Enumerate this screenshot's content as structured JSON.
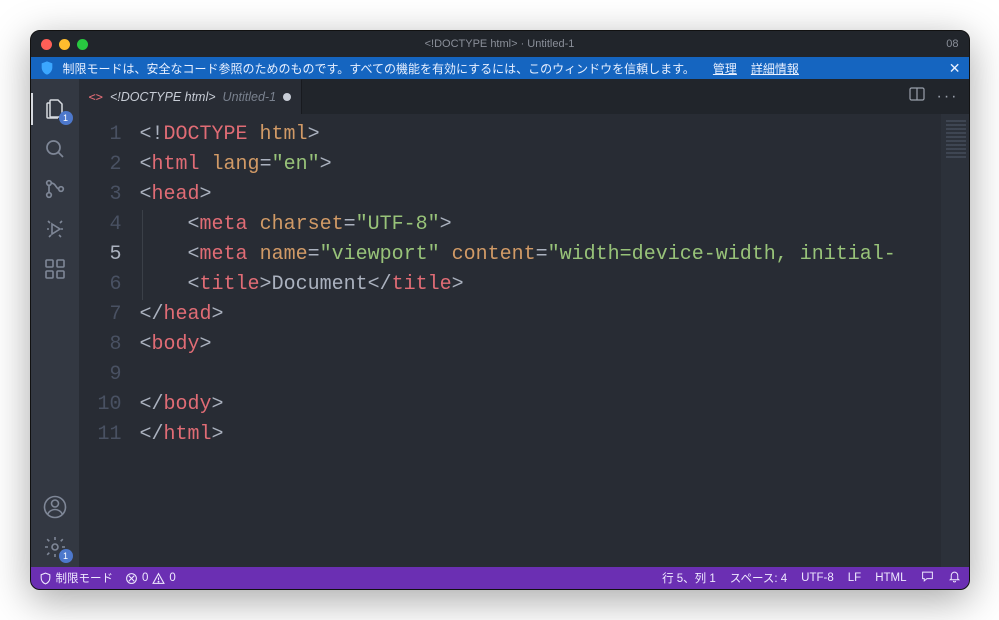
{
  "titlebar": {
    "title": "<!DOCTYPE html> · Untitled-1"
  },
  "right_toolbar": {
    "layout_label": "08"
  },
  "banner": {
    "message": "制限モードは、安全なコード参照のためのものです。すべての機能を有効にするには、このウィンドウを信頼します。",
    "manage_link": "管理",
    "details_link": "詳細情報"
  },
  "activity": {
    "explorer_badge": "1",
    "settings_badge": "1"
  },
  "tab": {
    "icon_text": "<>",
    "name": "<!DOCTYPE html>",
    "suffix": "Untitled-1"
  },
  "editor": {
    "line_count": 11,
    "current_line": 5,
    "lines": [
      {
        "n": 1,
        "html": "<span class='ang'>&lt;!</span><span class='tg'>DOCTYPE</span> <span class='atn'>html</span><span class='ang'>&gt;</span>"
      },
      {
        "n": 2,
        "html": "<span class='ang'>&lt;</span><span class='tg'>html</span> <span class='atn'>lang</span><span class='ang'>=</span><span class='atv'>\"en\"</span><span class='ang'>&gt;</span>"
      },
      {
        "n": 3,
        "html": "<span class='ang'>&lt;</span><span class='tg'>head</span><span class='ang'>&gt;</span>"
      },
      {
        "n": 4,
        "indent": true,
        "html": "    <span class='ang'>&lt;</span><span class='tg'>meta</span> <span class='atn'>charset</span><span class='ang'>=</span><span class='atv'>\"UTF-8\"</span><span class='ang'>&gt;</span>"
      },
      {
        "n": 5,
        "indent": true,
        "html": "    <span class='ang'>&lt;</span><span class='tg'>meta</span> <span class='atn'>name</span><span class='ang'>=</span><span class='atv'>\"viewport\"</span> <span class='atn'>content</span><span class='ang'>=</span><span class='atv'>\"width=device-width, initial-</span>"
      },
      {
        "n": 6,
        "indent": true,
        "html": "    <span class='ang'>&lt;</span><span class='tg'>title</span><span class='ang'>&gt;</span><span class='txt'>Document</span><span class='ang'>&lt;/</span><span class='tg'>title</span><span class='ang'>&gt;</span>"
      },
      {
        "n": 7,
        "html": "<span class='ang'>&lt;/</span><span class='tg'>head</span><span class='ang'>&gt;</span>"
      },
      {
        "n": 8,
        "html": "<span class='ang'>&lt;</span><span class='tg'>body</span><span class='ang'>&gt;</span>"
      },
      {
        "n": 9,
        "html": "    "
      },
      {
        "n": 10,
        "html": "<span class='ang'>&lt;/</span><span class='tg'>body</span><span class='ang'>&gt;</span>"
      },
      {
        "n": 11,
        "html": "<span class='ang'>&lt;/</span><span class='tg'>html</span><span class='ang'>&gt;</span>"
      }
    ]
  },
  "status": {
    "restricted_mode": "制限モード",
    "errors": "0",
    "warnings": "0",
    "cursor": "行 5、列 1",
    "indent": "スペース: 4",
    "encoding": "UTF-8",
    "eol": "LF",
    "language": "HTML"
  }
}
